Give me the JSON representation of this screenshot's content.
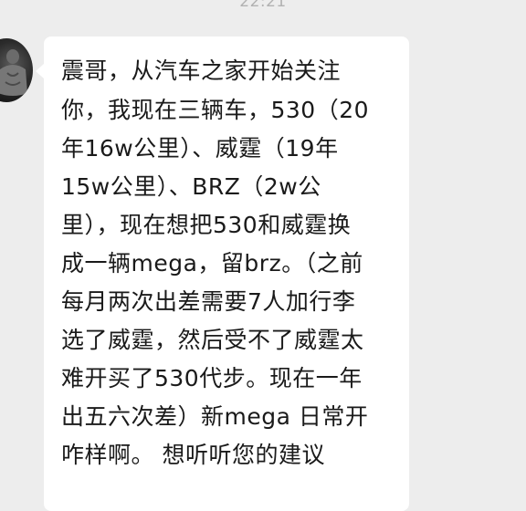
{
  "chat": {
    "timestamp": "22:21",
    "contact_avatar_icon": "user-avatar-icon",
    "message": {
      "lines": [
        "震哥，从汽车之家开始关注",
        "你，我现在三辆车，530（20",
        "年16w公里）、威霆（19年",
        "15w公里）、BRZ（2w公",
        "里），现在想把530和威霆换",
        "成一辆mega，留brz。（之前",
        "每月两次出差需要7人加行李",
        "选了威霆，然后受不了威霆太",
        "难开买了530代步。现在一年",
        "出五六次差）新mega 日常开",
        "咋样啊。 想听听您的建议"
      ]
    }
  }
}
